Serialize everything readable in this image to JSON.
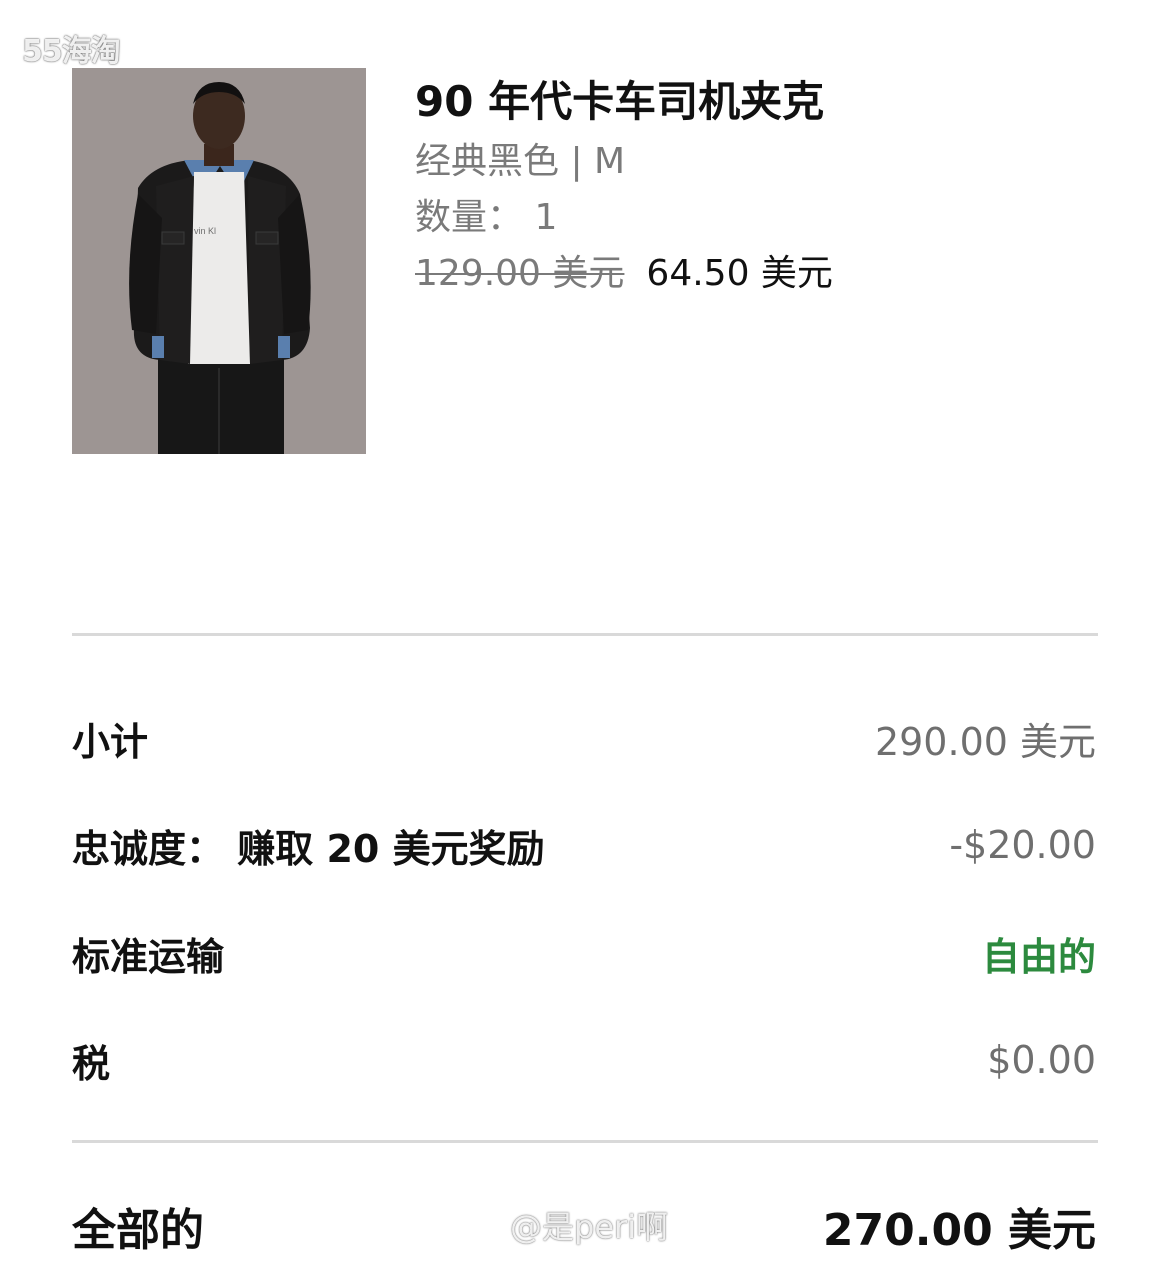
{
  "watermarks": {
    "top": "55海淘",
    "bottom": "@是peri啊"
  },
  "product": {
    "title": "90 年代卡车司机夹克",
    "variant": "经典黑色 | M",
    "quantity": "数量： 1",
    "original_price": "129.00 美元",
    "sale_price": "64.50 美元",
    "image_print": "vin Kl"
  },
  "summary": {
    "subtotal": {
      "label": "小计",
      "value": "290.00 美元"
    },
    "loyalty": {
      "label": "忠诚度： 赚取 20 美元奖励",
      "value": "-$20.00"
    },
    "shipping": {
      "label": "标准运输",
      "value": "自由的"
    },
    "tax": {
      "label": "税",
      "value": "$0.00"
    },
    "total": {
      "label": "全部的",
      "value": "270.00 美元"
    }
  },
  "colors": {
    "free_shipping": "#2c8a3e",
    "divider": "#d9d9d9",
    "muted_text": "#7a7a7a"
  }
}
